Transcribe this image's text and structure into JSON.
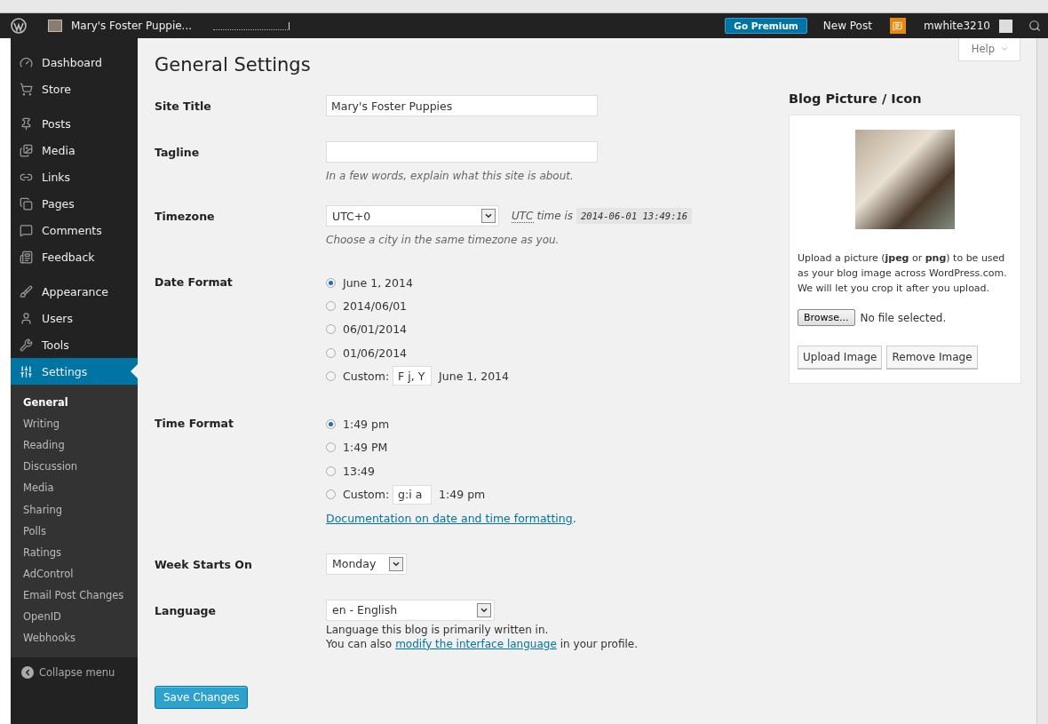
{
  "admin_bar": {
    "site_name": "Mary's Foster Puppie...",
    "go_premium": "Go Premium",
    "new_post": "New Post",
    "username": "mwhite3210"
  },
  "sidebar": {
    "groups": [
      [
        {
          "label": "Dashboard",
          "selected": false
        },
        {
          "label": "Store",
          "selected": false
        }
      ],
      [
        {
          "label": "Posts",
          "selected": false
        },
        {
          "label": "Media",
          "selected": false
        },
        {
          "label": "Links",
          "selected": false
        },
        {
          "label": "Pages",
          "selected": false
        },
        {
          "label": "Comments",
          "selected": false
        },
        {
          "label": "Feedback",
          "selected": false
        }
      ],
      [
        {
          "label": "Appearance",
          "selected": false
        },
        {
          "label": "Users",
          "selected": false
        },
        {
          "label": "Tools",
          "selected": false
        },
        {
          "label": "Settings",
          "selected": true
        }
      ]
    ],
    "submenu": [
      {
        "label": "General",
        "selected": true
      },
      {
        "label": "Writing",
        "selected": false
      },
      {
        "label": "Reading",
        "selected": false
      },
      {
        "label": "Discussion",
        "selected": false
      },
      {
        "label": "Media",
        "selected": false
      },
      {
        "label": "Sharing",
        "selected": false
      },
      {
        "label": "Polls",
        "selected": false
      },
      {
        "label": "Ratings",
        "selected": false
      },
      {
        "label": "AdControl",
        "selected": false
      },
      {
        "label": "Email Post Changes",
        "selected": false
      },
      {
        "label": "OpenID",
        "selected": false
      },
      {
        "label": "Webhooks",
        "selected": false
      }
    ],
    "collapse": "Collapse menu"
  },
  "help": "Help",
  "page_title": "General Settings",
  "site_title": {
    "label": "Site Title",
    "value": "Mary's Foster Puppies"
  },
  "tagline": {
    "label": "Tagline",
    "description": "In a few words, explain what this site is about."
  },
  "timezone": {
    "label": "Timezone",
    "value": "UTC+0",
    "utc_label": "UTC",
    "utc_text": "time is",
    "utc_time": "2014-06-01 13:49:16",
    "description": "Choose a city in the same timezone as you."
  },
  "date_format": {
    "label": "Date Format",
    "options": [
      {
        "kind": "preset",
        "label": "June 1, 2014",
        "selected": true
      },
      {
        "kind": "preset",
        "label": "2014/06/01",
        "selected": false
      },
      {
        "kind": "preset",
        "label": "06/01/2014",
        "selected": false
      },
      {
        "kind": "preset",
        "label": "01/06/2014",
        "selected": false
      },
      {
        "kind": "custom",
        "label": "Custom:",
        "value": "F j, Y",
        "preview": "June 1, 2014",
        "selected": false
      }
    ]
  },
  "time_format": {
    "label": "Time Format",
    "options": [
      {
        "kind": "preset",
        "label": "1:49 pm",
        "selected": true
      },
      {
        "kind": "preset",
        "label": "1:49 PM",
        "selected": false
      },
      {
        "kind": "preset",
        "label": "13:49",
        "selected": false
      },
      {
        "kind": "custom",
        "label": "Custom:",
        "value": "g:i a",
        "preview": "1:49 pm",
        "selected": false
      }
    ],
    "doc_link": "Documentation on date and time formatting",
    "doc_suffix": "."
  },
  "week_starts": {
    "label": "Week Starts On",
    "value": "Monday"
  },
  "language": {
    "label": "Language",
    "value": "en - English",
    "description": "Language this blog is primarily written in.",
    "note_prefix": "You can also",
    "note_link": "modify the interface language",
    "note_suffix": "in your profile."
  },
  "save_button": "Save Changes",
  "blog_picture": {
    "title": "Blog Picture / Icon",
    "description": "Upload a picture (**jpeg** or **png**) to be used as your blog image across WordPress.com. We will let you crop it after you upload.",
    "browse": "Browse...",
    "no_file": "No file selected.",
    "upload": "Upload Image",
    "remove": "Remove Image"
  }
}
